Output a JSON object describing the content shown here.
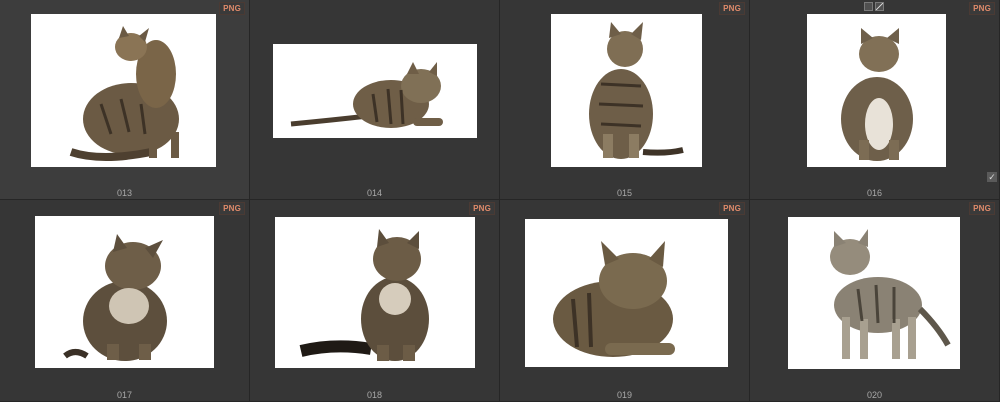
{
  "badge_text": "PNG",
  "check_glyph": "✓",
  "items": [
    {
      "label": "013",
      "icon": "cat-sitting-looking-back-icon"
    },
    {
      "label": "014",
      "icon": "cat-crouching-icon"
    },
    {
      "label": "015",
      "icon": "cat-sitting-icon"
    },
    {
      "label": "016",
      "icon": "cat-sitting-front-icon"
    },
    {
      "label": "017",
      "icon": "cat-sitting-head-tilt-icon"
    },
    {
      "label": "018",
      "icon": "kitten-sitting-icon"
    },
    {
      "label": "019",
      "icon": "cat-lying-icon"
    },
    {
      "label": "020",
      "icon": "cat-walking-icon"
    }
  ]
}
